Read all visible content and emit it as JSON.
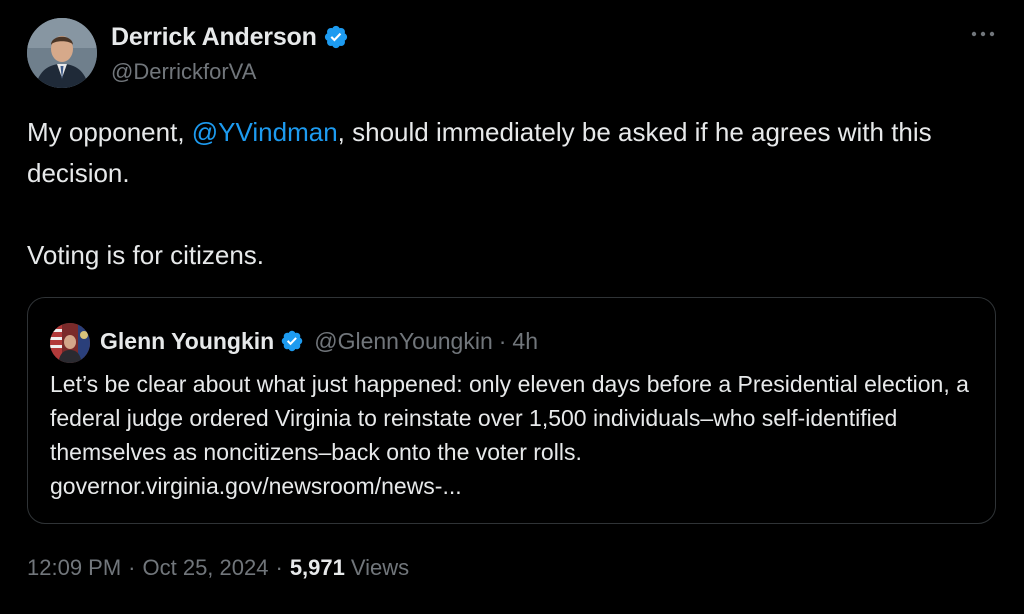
{
  "author": {
    "display_name": "Derrick Anderson",
    "handle": "@DerrickforVA",
    "verified": true
  },
  "tweet": {
    "text_before_mention": "My opponent, ",
    "mention": "@YVindman",
    "text_after_mention": ", should immediately be asked if he agrees with this decision.",
    "text_paragraph_2": "Voting is for citizens."
  },
  "quote": {
    "display_name": "Glenn Youngkin",
    "handle": "@GlennYoungkin",
    "separator": "·",
    "time": "4h",
    "verified": true,
    "text": "Let’s be clear about what just happened: only eleven days before a Presidential election, a federal judge ordered Virginia to reinstate over 1,500 individuals–who self-identified themselves as noncitizens–back onto the voter rolls.",
    "link": "governor.virginia.gov/newsroom/news-..."
  },
  "meta": {
    "time": "12:09 PM",
    "separator": "·",
    "date": "Oct 25, 2024",
    "views_count": "5,971",
    "views_label": "Views"
  },
  "icons": {
    "verified": "verified-badge-icon",
    "more": "more-horizontal-icon"
  },
  "colors": {
    "background": "#000000",
    "text": "#e7e9ea",
    "secondary": "#71767b",
    "accent": "#1d9bf0",
    "border": "#2f3336"
  }
}
